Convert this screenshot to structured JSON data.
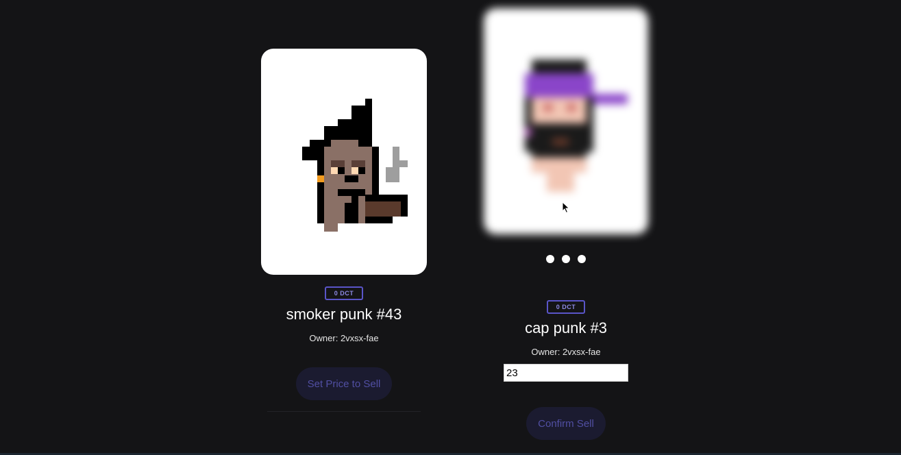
{
  "nfts": [
    {
      "price": "0 DCT",
      "name": "smoker punk #43",
      "owner_label": "Owner:",
      "owner": "2vxsx-fae",
      "button_label": "Set Price to Sell",
      "image_alt": "smoker punk pixel art"
    },
    {
      "price": "0 DCT",
      "name": "cap punk #3",
      "owner_label": "Owner:",
      "owner": "2vxsx-fae",
      "price_input_value": "23",
      "button_label": "Confirm Sell",
      "image_alt": "cap punk pixel art",
      "state": "loading"
    }
  ],
  "colors": {
    "background": "#141416",
    "badge_border": "#5a55c9",
    "button_bg": "#1b1b30",
    "button_text": "#514fa3"
  }
}
